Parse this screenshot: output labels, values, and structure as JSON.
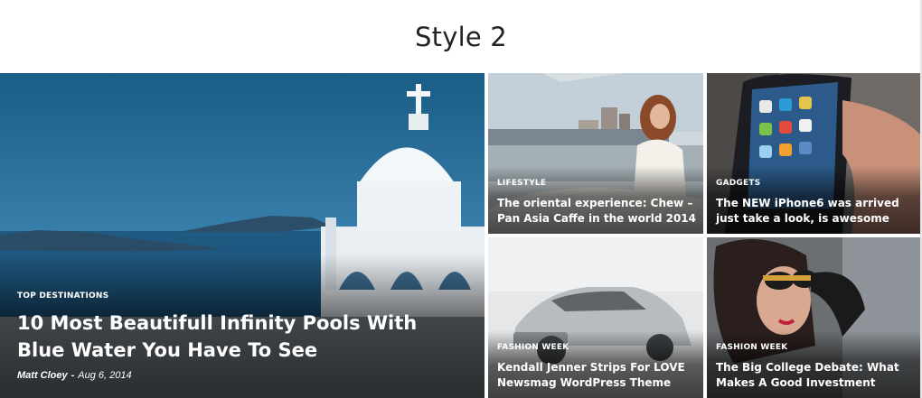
{
  "section": {
    "title": "Style 2"
  },
  "tiles": [
    {
      "category": "TOP DESTINATIONS",
      "title": "10 Most Beautifull Infinity Pools With Blue Water You Have To See",
      "author": "Matt Cloey",
      "date": "Aug 6, 2014"
    },
    {
      "category": "LIFESTYLE",
      "title": "The oriental experience: Chew – Pan Asia Caffe in the world 2014"
    },
    {
      "category": "GADGETS",
      "title": "The NEW iPhone6 was arrived just take a look, is awesome"
    },
    {
      "category": "FASHION WEEK",
      "title": "Kendall Jenner Strips For LOVE Newsmag WordPress Theme"
    },
    {
      "category": "FASHION WEEK",
      "title": "The Big College Debate: What Makes A Good Investment"
    }
  ],
  "meta_separator": "-",
  "images": [
    {
      "icon": "santorini-church-photo"
    },
    {
      "icon": "woman-on-yacht-photo"
    },
    {
      "icon": "iphone-in-hand-photo"
    },
    {
      "icon": "silver-sports-car-photo"
    },
    {
      "icon": "woman-with-sunglasses-photo"
    }
  ]
}
